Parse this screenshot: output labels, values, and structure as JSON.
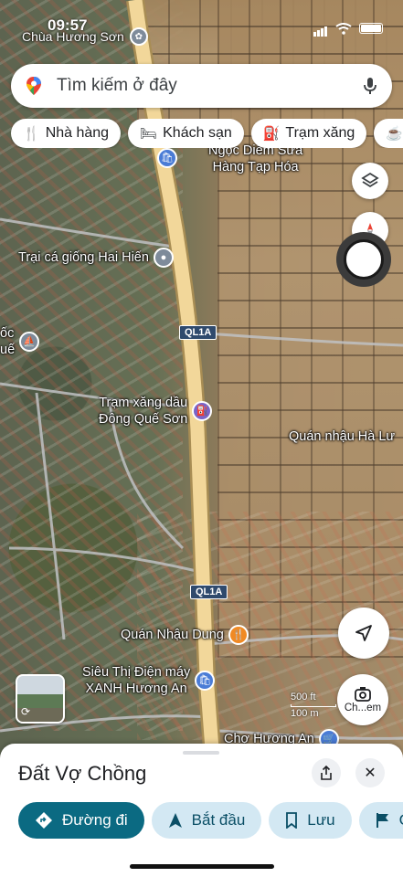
{
  "status_bar": {
    "time": "09:57"
  },
  "map": {
    "top_place": "Chùa Hương Sơn",
    "route_label_1": "QL1A",
    "route_label_2": "QL1A",
    "pois": {
      "ngoc_diem": "Ngọc Diễm Sữa\nHàng Tạp Hóa",
      "trai_ca": "Trại cá giống Hai Hiến",
      "oc_que": "ốc\nuế",
      "tram_xang": "Trạm xăng dầu\nĐông Quế Sơn",
      "quan_nhau_ha_luu": "Quán nhậu Hà Lư",
      "quan_nhau_dung": "Quán Nhậu Dung",
      "sieu_thi": "Siêu Thị Điện máy\nXANH Hương An",
      "cho": "Chợ Hương An"
    },
    "scale": {
      "top": "500 ft",
      "bottom": "100 m"
    },
    "camera_label": "Ch...em"
  },
  "search": {
    "placeholder": "Tìm kiếm ở đây"
  },
  "chips": [
    {
      "icon": "restaurant-icon",
      "label": "Nhà hàng"
    },
    {
      "icon": "hotel-icon",
      "label": "Khách sạn"
    },
    {
      "icon": "gas-station-icon",
      "label": "Trạm xăng"
    },
    {
      "icon": "coffee-icon",
      "label": "C"
    }
  ],
  "sheet": {
    "title": "Đất Vợ Chồng",
    "actions": [
      {
        "icon": "directions-icon",
        "label": "Đường đi"
      },
      {
        "icon": "navigation-arrow-icon",
        "label": "Bắt đầu"
      },
      {
        "icon": "bookmark-icon",
        "label": "Lưu"
      },
      {
        "icon": "flag-icon",
        "label": "C"
      }
    ]
  },
  "colors": {
    "accent": "#0b6a82",
    "action_chip_bg": "#d3e8f3",
    "route_label_bg": "#2f4a6d",
    "highway": "#f2d79a"
  }
}
